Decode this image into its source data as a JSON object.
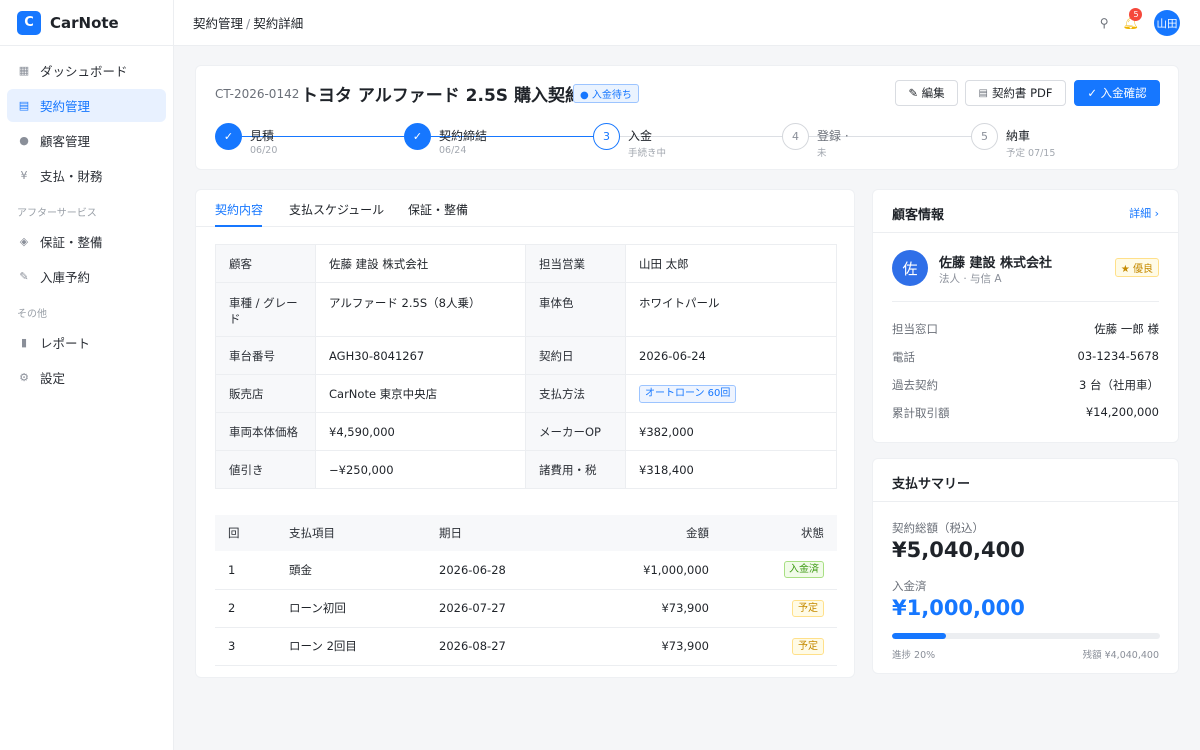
{
  "brand": {
    "logo_letter": "C",
    "name": "CarNote"
  },
  "sidebar": {
    "items": [
      {
        "label": "ダッシュボード",
        "icon": "grid-icon"
      },
      {
        "label": "契約管理",
        "icon": "document-icon",
        "active": true
      },
      {
        "label": "顧客管理",
        "icon": "user-icon"
      },
      {
        "label": "支払・財務",
        "icon": "yen-icon"
      }
    ],
    "section_after": "アフターサービス",
    "after_items": [
      {
        "label": "保証・整備",
        "icon": "shield-icon"
      },
      {
        "label": "入庫予約",
        "icon": "wrench-icon"
      }
    ],
    "section_other": "その他",
    "other_items": [
      {
        "label": "レポート",
        "icon": "chart-icon"
      },
      {
        "label": "設定",
        "icon": "gear-icon"
      }
    ]
  },
  "topbar": {
    "breadcrumb": [
      "契約管理",
      "契約詳細"
    ],
    "notification_count": "5",
    "avatar_text": "山田"
  },
  "header": {
    "contract_id": "CT-2026-0142",
    "title": "トヨタ アルファード 2.5S 購入契約",
    "status": "● 入金待ち",
    "buttons": {
      "edit": "✎ 編集",
      "pdf": "契約書 PDF",
      "confirm": "✓ 入金確認"
    }
  },
  "steps": [
    {
      "label": "見積",
      "sub": "06/20",
      "state": "done",
      "mark": "✓"
    },
    {
      "label": "契約締結",
      "sub": "06/24",
      "state": "done",
      "mark": "✓"
    },
    {
      "label": "入金",
      "sub": "手続き中",
      "state": "current",
      "mark": "3"
    },
    {
      "label": "登録 ·",
      "sub": "未",
      "state": "todo",
      "mark": "4"
    },
    {
      "label": "納車",
      "sub": "予定 07/15",
      "state": "todo",
      "mark": "5"
    }
  ],
  "tabs": [
    "契約内容",
    "支払スケジュール",
    "保証・整備"
  ],
  "spec": {
    "rows": [
      {
        "k1": "顧客",
        "v1": "佐藤 建設 株式会社",
        "k2": "担当営業",
        "v2": "山田 太郎"
      },
      {
        "k1": "車種 / グレード",
        "v1": "アルファード 2.5S（8人乗）",
        "k2": "車体色",
        "v2": "ホワイトパール"
      },
      {
        "k1": "車台番号",
        "v1": "AGH30-8041267",
        "k2": "契約日",
        "v2": "2026-06-24"
      },
      {
        "k1": "販売店",
        "v1": "CarNote 東京中央店",
        "k2": "支払方法",
        "v2": "オートローン 60回"
      },
      {
        "k1": "車両本体価格",
        "v1": "¥4,590,000",
        "k2": "メーカーOP",
        "v2": "¥382,000"
      },
      {
        "k1": "値引き",
        "v1": "−¥250,000",
        "k2": "諸費用・税",
        "v2": "¥318,400"
      }
    ]
  },
  "schedule": {
    "headers": [
      "回",
      "支払項目",
      "期日",
      "金額",
      "状態"
    ],
    "rows": [
      {
        "no": "1",
        "item": "頭金",
        "date": "2026-06-28",
        "amount": "¥1,000,000",
        "status": "入金済"
      },
      {
        "no": "2",
        "item": "ローン初回",
        "date": "2026-07-27",
        "amount": "¥73,900",
        "status": "予定"
      },
      {
        "no": "3",
        "item": "ローン 2回目",
        "date": "2026-08-27",
        "amount": "¥73,900",
        "status": "予定"
      }
    ]
  },
  "customer": {
    "title": "顧客情報",
    "detail_link": "詳細 ›",
    "avatar": "佐",
    "name": "佐藤 建設 株式会社",
    "sub": "法人 · 与信 A",
    "badge": "★ 優良",
    "fields": [
      {
        "k": "担当窓口",
        "v": "佐藤 一郎 様"
      },
      {
        "k": "電話",
        "v": "03-1234-5678"
      },
      {
        "k": "過去契約",
        "v": "3 台（社用車）"
      },
      {
        "k": "累計取引額",
        "v": "¥14,200,000"
      }
    ]
  },
  "summary": {
    "title": "支払サマリー",
    "total_label": "契約総額（税込）",
    "total": "¥5,040,400",
    "paid_label": "入金済",
    "paid": "¥1,000,000",
    "progress_percent": 20,
    "progress_text": "進捗 20%",
    "remaining_text": "残額 ¥4,040,400"
  },
  "colors": {
    "accent": "#1677ff",
    "negative": "#e8453c",
    "success": "#3e9b14",
    "warning": "#c58a00"
  }
}
